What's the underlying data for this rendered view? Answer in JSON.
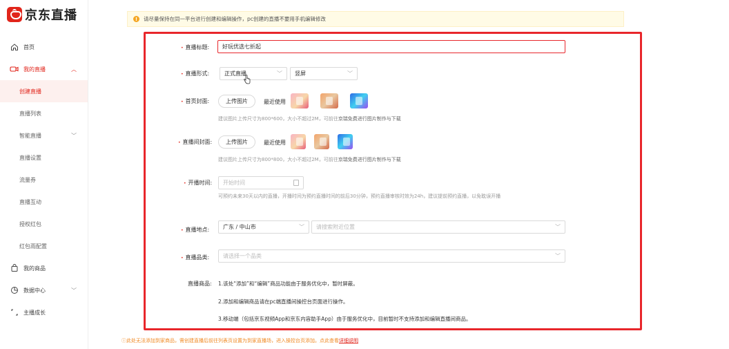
{
  "app": {
    "logo_text": "京东直播",
    "brand_color": "#e1251b"
  },
  "sidebar": {
    "items": [
      {
        "label": "首页",
        "icon": "home-icon"
      },
      {
        "label": "我的直播",
        "icon": "video-camera-icon"
      },
      {
        "label": "创建直播"
      },
      {
        "label": "直播列表"
      },
      {
        "label": "智能直播"
      },
      {
        "label": "直播设置"
      },
      {
        "label": "流量券"
      },
      {
        "label": "直播互动"
      },
      {
        "label": "授权红包"
      },
      {
        "label": "红包雨配置"
      },
      {
        "label": "我的商品",
        "icon": "shopping-bag-icon"
      },
      {
        "label": "数据中心",
        "icon": "pie-chart-icon"
      },
      {
        "label": "主播成长",
        "icon": "growth-icon"
      }
    ]
  },
  "notice": {
    "text": "请尽量保持在同一平台进行创建和编辑操作，pc创建的直播不要用手机编辑修改",
    "icon": "warning-icon",
    "color": "#f5a623"
  },
  "form": {
    "title": {
      "label": "直播标题:",
      "value": "好玩优选七折起"
    },
    "form_type": {
      "label": "直播形式:",
      "value": "正式直播",
      "orientation": "竖屏"
    },
    "cover": {
      "label": "首页封面:",
      "upload": "上传图片",
      "recent": "最近使用",
      "hint": "建议图片上传尺寸为800*600，大小不超过2M，可前往",
      "hint_link": "京瑞免费进行图片制作与下载"
    },
    "room_cover": {
      "label": "直播间封面:",
      "upload": "上传图片",
      "recent": "最近使用",
      "hint": "建议图片上传尺寸为800*800，大小不超过2M，可前往",
      "hint_link": "京瑞免费进行图片制作与下载"
    },
    "start_time": {
      "label": "开播时间:",
      "placeholder": "开始时间",
      "hint": "可预约未来30天以内的直播，开播时间为预约直播时间的前后30分钟，预约直播审核时效为24h，建议提前预约直播，以免耽误开播"
    },
    "location": {
      "label": "直播地点:",
      "value": "广东 / 中山市",
      "placeholder": "请搜索附近位置"
    },
    "category": {
      "label": "直播品类:",
      "placeholder": "请选择一个品类"
    },
    "goods": {
      "label": "直播商品:",
      "lines": [
        "1.该处“添加”和“编辑”商品功能由于服务优化中，暂时屏蔽。",
        "2.添加和编辑商品请在pc端直播间操控台页面进行操作。",
        "3.移动端（包括京东视频App和京东内容助手App）由于服务优化中，目前暂时不支持添加和编辑直播间商品。"
      ]
    }
  },
  "bottom_note": {
    "text": "ⓘ此处无法添加到家商品，需创建直播后前往列表页设置为到家直播场，进入操控台页添加。点此查看",
    "link": "详细说明"
  }
}
